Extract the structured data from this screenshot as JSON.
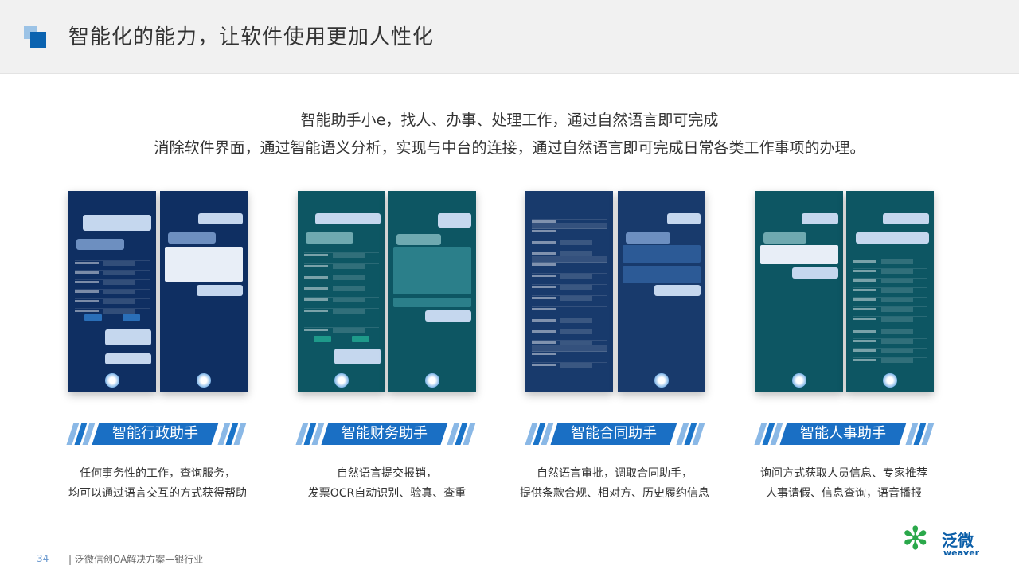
{
  "header": {
    "title": "智能化的能力，让软件使用更加人性化"
  },
  "intro": {
    "line1": "智能助手小e，找人、办事、处理工作，通过自然语言即可完成",
    "line2": "消除软件界面，通过智能语义分析，实现与中台的连接，通过自然语言即可完成日常各类工作事项的办理。"
  },
  "features": [
    {
      "label": "智能行政助手",
      "desc1": "任何事务性的工作，查询服务，",
      "desc2": "均可以通过语言交互的方式获得帮助"
    },
    {
      "label": "智能财务助手",
      "desc1": "自然语言提交报销，",
      "desc2": "发票OCR自动识别、验真、查重"
    },
    {
      "label": "智能合同助手",
      "desc1": "自然语言审批，调取合同助手，",
      "desc2": "提供条款合规、相对方、历史履约信息"
    },
    {
      "label": "智能人事助手",
      "desc1": "询问方式获取人员信息、专家推荐",
      "desc2": "人事请假、信息查询，语音播报"
    }
  ],
  "footer": {
    "page_number": "34",
    "text": "| 泛微信创OA解决方案—银行业"
  },
  "brand": {
    "name_cn": "泛微",
    "name_en": "weaver"
  },
  "colors": {
    "accent": "#1a6fc4",
    "header_bg": "#f1f1f1",
    "phone_blue": "#0f2f62",
    "phone_teal": "#0d5663",
    "brand_green": "#2aa84a"
  }
}
